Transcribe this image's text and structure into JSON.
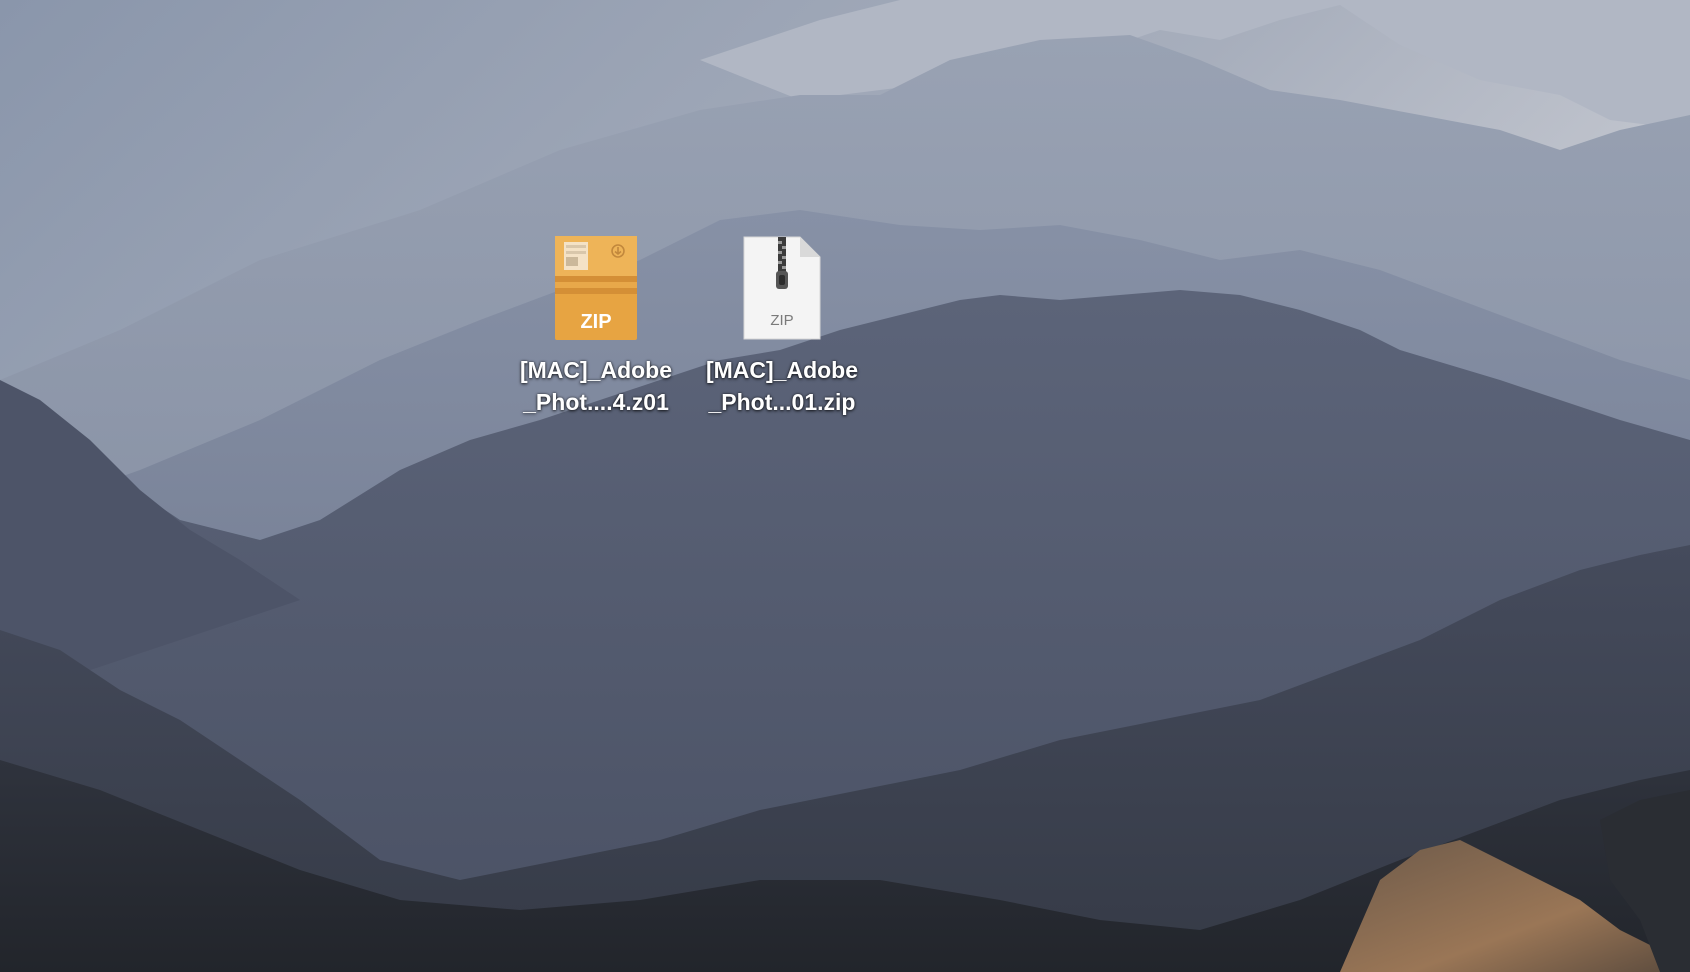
{
  "desktop": {
    "icons": [
      {
        "line1": "[MAC]_Adobe",
        "line2": "_Phot....4.z01",
        "badge": "ZIP",
        "icon_name": "archive-utility-zip-icon",
        "accent": "#e3a645"
      },
      {
        "line1": "[MAC]_Adobe",
        "line2": "_Phot...01.zip",
        "badge": "ZIP",
        "icon_name": "zip-document-icon",
        "accent": "#f4f4f4"
      }
    ]
  },
  "colors": {
    "sky": "#cfd2d9",
    "far_ridge": "#a9b0c0",
    "mid_ridge": "#737d93",
    "near_ridge": "#3f4656",
    "foreground": "#23262c",
    "brown_slope": "#8a6a4a"
  }
}
